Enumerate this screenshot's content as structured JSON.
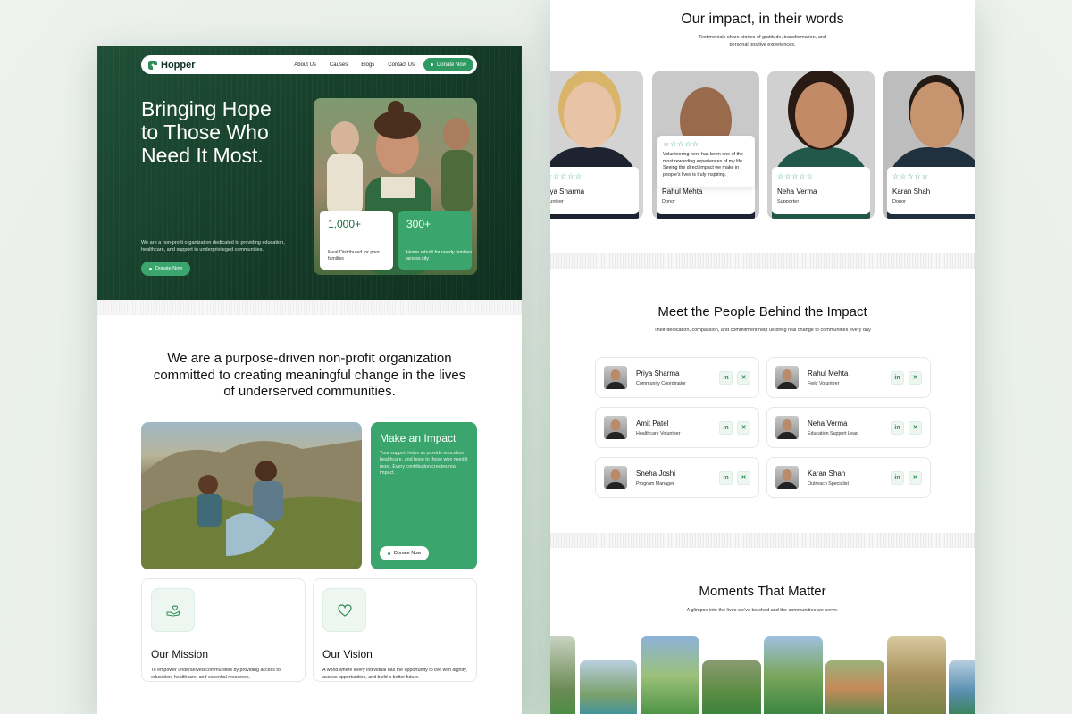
{
  "left": {
    "nav": {
      "brand": "Hopper",
      "links": [
        "About Us",
        "Causes",
        "Blogs",
        "Contact Us"
      ],
      "cta": "Donate Now"
    },
    "hero": {
      "headline": "Bringing Hope to Those Who Need It Most.",
      "description": "We are a non-profit organization dedicated to providing education, healthcare, and support to underprivileged communities.",
      "cta": "Donate Now",
      "stats": [
        {
          "value": "1,000+",
          "label": "Meal Distributed for poor families"
        },
        {
          "value": "300+",
          "label": "Home rebuilt for needy families across city"
        }
      ]
    },
    "about": {
      "statement": "We are a purpose-driven non-profit organization committed to creating meaningful change in the lives of underserved communities."
    },
    "impact": {
      "title": "Make an Impact",
      "text": "Your support helps us provide education, healthcare, and hope to those who need it most. Every contribution creates real impact.",
      "cta": "Donate Now"
    },
    "mission": {
      "icon": "hand-holding-heart-icon",
      "title": "Our Mission",
      "text": "To empower underserved communities by providing access to education, healthcare, and essential resources."
    },
    "vision": {
      "icon": "heart-icon",
      "title": "Our Vision",
      "text": "A world where every individual has the opportunity to live with dignity, access opportunities, and build a better future."
    }
  },
  "right": {
    "testimonials": {
      "title": "Our impact, in their words",
      "subtitle": "Testimonials share stories of gratitude, transformation, and personal positive experiences.",
      "stars": "☆☆☆☆☆",
      "items": [
        {
          "name": "riya Sharma",
          "role": "olunteer"
        },
        {
          "name": "Rahul Mehta",
          "role": "Donor",
          "quote": "Volunteering here has been one of the most rewarding experiences of my life. Seeing the direct impact we make in people's lives is truly inspiring."
        },
        {
          "name": "Neha Verma",
          "role": "Supporter"
        },
        {
          "name": "Karan Shah",
          "role": "Donor"
        }
      ]
    },
    "team": {
      "title": "Meet the People Behind the Impact",
      "subtitle": "Their dedication, compassion, and commitment help us bring real change to communities every day",
      "members": [
        {
          "name": "Priya Sharma",
          "role": "Community Coordinator"
        },
        {
          "name": "Rahul Mehta",
          "role": "Field Volunteer"
        },
        {
          "name": "Amit Patel",
          "role": "Healthcare Volunteer"
        },
        {
          "name": "Neha Verma",
          "role": "Education Support Lead"
        },
        {
          "name": "Sneha Joshi",
          "role": "Program Manager"
        },
        {
          "name": "Karan Shah",
          "role": "Outreach Specialist"
        }
      ],
      "social_icons": [
        "linkedin-icon",
        "x-icon"
      ]
    },
    "moments": {
      "title": "Moments That Matter",
      "subtitle": "A glimpse into the lives we've touched and the communities we serve."
    }
  },
  "colors": {
    "brand_green": "#3aa56c",
    "hero_dark_green": "#1f4f36",
    "accent_dark": "#2e9a62"
  }
}
